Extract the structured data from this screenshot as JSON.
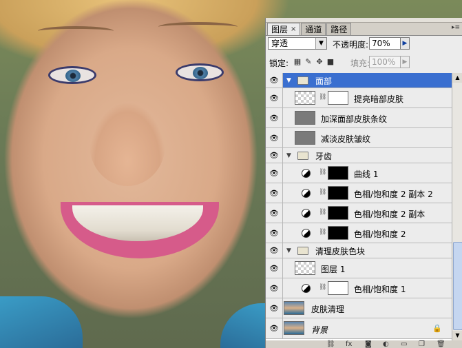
{
  "panel": {
    "tabs": [
      {
        "label": "图层",
        "close": "×"
      },
      {
        "label": "通道"
      },
      {
        "label": "路径"
      }
    ],
    "menu_icon": "▸≡",
    "blend_mode": "穿透",
    "opacity_label": "不透明度:",
    "opacity_value": "70%",
    "lock_label": "锁定:",
    "fill_label": "填充:",
    "fill_value": "100%"
  },
  "layers": [
    {
      "type": "group",
      "name": "面部",
      "selected": true,
      "expanded": true
    },
    {
      "type": "layer",
      "name": "提亮暗部皮肤",
      "thumb": "checker",
      "mask": "white",
      "indent": 1
    },
    {
      "type": "layer",
      "name": "加深面部皮肤条纹",
      "thumb": "gray",
      "indent": 1
    },
    {
      "type": "layer",
      "name": "减淡皮肤皱纹",
      "thumb": "gray",
      "indent": 1
    },
    {
      "type": "group",
      "name": "牙齿",
      "expanded": true
    },
    {
      "type": "adjust",
      "name": "曲线 1",
      "mask": "black",
      "indent": 1
    },
    {
      "type": "adjust",
      "name": "色相/饱和度 2 副本 2",
      "mask": "black",
      "indent": 1
    },
    {
      "type": "adjust",
      "name": "色相/饱和度 2 副本",
      "mask": "black",
      "indent": 1
    },
    {
      "type": "adjust",
      "name": "色相/饱和度 2",
      "mask": "black",
      "indent": 1
    },
    {
      "type": "group",
      "name": "清理皮肤色块",
      "expanded": true
    },
    {
      "type": "layer",
      "name": "图层 1",
      "thumb": "checker",
      "indent": 1
    },
    {
      "type": "adjust",
      "name": "色相/饱和度 1",
      "mask": "white",
      "indent": 1
    },
    {
      "type": "layer",
      "name": "皮肤清理",
      "thumb": "photo"
    },
    {
      "type": "layer",
      "name": "背景",
      "thumb": "photo",
      "italic": true,
      "locked": true
    }
  ],
  "icons": {
    "eye": "eye-icon",
    "lock": "lock-icon",
    "link": "link-icon",
    "fx": "fx-icon",
    "mask": "add-mask-icon",
    "adjustment": "new-adjustment-icon",
    "group": "new-group-icon",
    "new": "new-layer-icon",
    "trash": "trash-icon"
  },
  "colors": {
    "selection": "#3a6fd0",
    "panel_bg": "#d4d0c8"
  }
}
